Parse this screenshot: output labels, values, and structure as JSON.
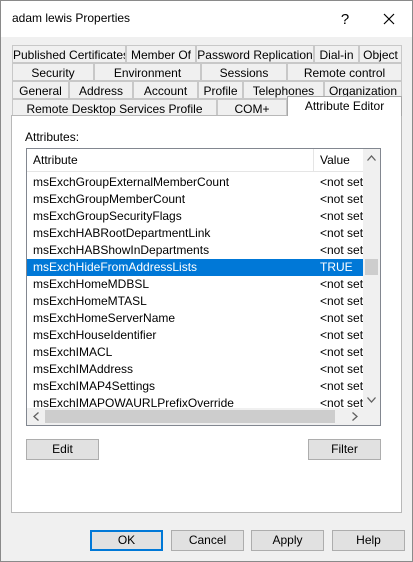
{
  "window": {
    "title": "adam lewis Properties"
  },
  "icons": {
    "help": "help-icon",
    "close": "close-icon"
  },
  "tabs": {
    "row1": [
      "Published Certificates",
      "Member Of",
      "Password Replication",
      "Dial-in",
      "Object"
    ],
    "row2": [
      "Security",
      "Environment",
      "Sessions",
      "Remote control"
    ],
    "row3": [
      "General",
      "Address",
      "Account",
      "Profile",
      "Telephones",
      "Organization"
    ],
    "row4": [
      "Remote Desktop Services Profile",
      "COM+",
      "Attribute Editor"
    ],
    "active": "Attribute Editor"
  },
  "attribute_editor": {
    "label": "Attributes:",
    "columns": {
      "attribute": "Attribute",
      "value": "Value"
    },
    "rows": [
      {
        "attribute": "msExchGroupExternalMemberCount",
        "value": "<not set>"
      },
      {
        "attribute": "msExchGroupMemberCount",
        "value": "<not set>"
      },
      {
        "attribute": "msExchGroupSecurityFlags",
        "value": "<not set>"
      },
      {
        "attribute": "msExchHABRootDepartmentLink",
        "value": "<not set>"
      },
      {
        "attribute": "msExchHABShowInDepartments",
        "value": "<not set>"
      },
      {
        "attribute": "msExchHideFromAddressLists",
        "value": "TRUE",
        "selected": true
      },
      {
        "attribute": "msExchHomeMDBSL",
        "value": "<not set>"
      },
      {
        "attribute": "msExchHomeMTASL",
        "value": "<not set>"
      },
      {
        "attribute": "msExchHomeServerName",
        "value": "<not set>"
      },
      {
        "attribute": "msExchHouseIdentifier",
        "value": "<not set>"
      },
      {
        "attribute": "msExchIMACL",
        "value": "<not set>"
      },
      {
        "attribute": "msExchIMAddress",
        "value": "<not set>"
      },
      {
        "attribute": "msExchIMAP4Settings",
        "value": "<not set>"
      },
      {
        "attribute": "msExchIMAPOWAURLPrefixOverride",
        "value": "<not set>"
      }
    ],
    "edit_label": "Edit",
    "filter_label": "Filter"
  },
  "footer": {
    "ok_label": "OK",
    "cancel_label": "Cancel",
    "apply_label": "Apply",
    "help_label": "Help"
  }
}
